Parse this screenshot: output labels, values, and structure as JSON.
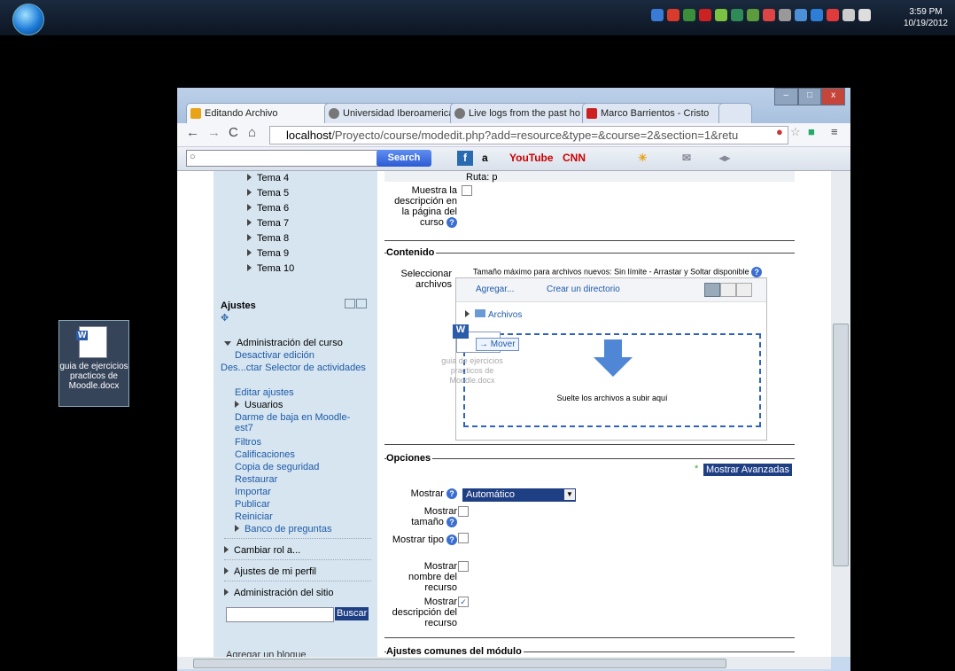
{
  "taskbar": {
    "time": "3:59 PM",
    "date": "10/19/2012"
  },
  "desktop": {
    "file_label": "guia de ejercicios practicos de Moodle.docx"
  },
  "browser": {
    "tabs": [
      {
        "label": "Editando Archivo",
        "color": "#e8a317"
      },
      {
        "label": "Universidad Iberoamerican",
        "color": "#777777"
      },
      {
        "label": "Live logs from the past ho",
        "color": "#777777"
      },
      {
        "label": "Marco Barrientos - Cristo",
        "color": "#cc1f1f"
      }
    ],
    "url_host": "localhost",
    "url_path": "/Proyecto/course/modedit.php?add=resource&type=&course=2&section=1&retu",
    "search_button": "Search",
    "toolbar_items": [
      "a",
      "YouTube",
      "CNN"
    ]
  },
  "sidebar": {
    "topics": [
      "Tema 4",
      "Tema 5",
      "Tema 6",
      "Tema 7",
      "Tema 8",
      "Tema 9",
      "Tema 10"
    ],
    "settings_title": "Ajustes",
    "course_admin": "Administración del curso",
    "course_items": [
      "Desactivar edición",
      "Des...ctar Selector de actividades",
      "Editar ajustes",
      "Usuarios",
      "Darme de baja en Moodle-est7",
      "Filtros",
      "Calificaciones",
      "Copia de seguridad",
      "Restaurar",
      "Importar",
      "Publicar",
      "Reiniciar",
      "Banco de preguntas"
    ],
    "collapsed": [
      "Cambiar rol a...",
      "Ajustes de mi perfil",
      "Administración del sitio"
    ],
    "search_button": "Buscar",
    "add_block": "Agregar un bloque"
  },
  "main": {
    "ruta": "Ruta: p",
    "show_desc_label": "Muestra la descripción en la página del curso",
    "contenido": {
      "legend": "Contenido",
      "select_label": "Seleccionar archivos",
      "max_size": "Tamaño máximo para archivos nuevos: Sin límite - Arrastar y Soltar disponible",
      "add": "Agregar...",
      "create_dir": "Crear un directorio",
      "folder": "Archivos",
      "drag_move": "Mover",
      "drag_file": "guia de ejercicios practicos de Moodle.docx",
      "drop_text": "Suelte los archivos a subir aquí"
    },
    "opciones": {
      "legend": "Opciones",
      "advanced": "Mostrar Avanzadas",
      "mostrar_label": "Mostrar",
      "mostrar_value": "Automático",
      "size_label": "Mostrar tamaño",
      "type_label": "Mostrar tipo",
      "name_label": "Mostrar nombre del recurso",
      "desc_label": "Mostrar descripción del recurso"
    },
    "common_legend": "Ajustes comunes del módulo"
  }
}
